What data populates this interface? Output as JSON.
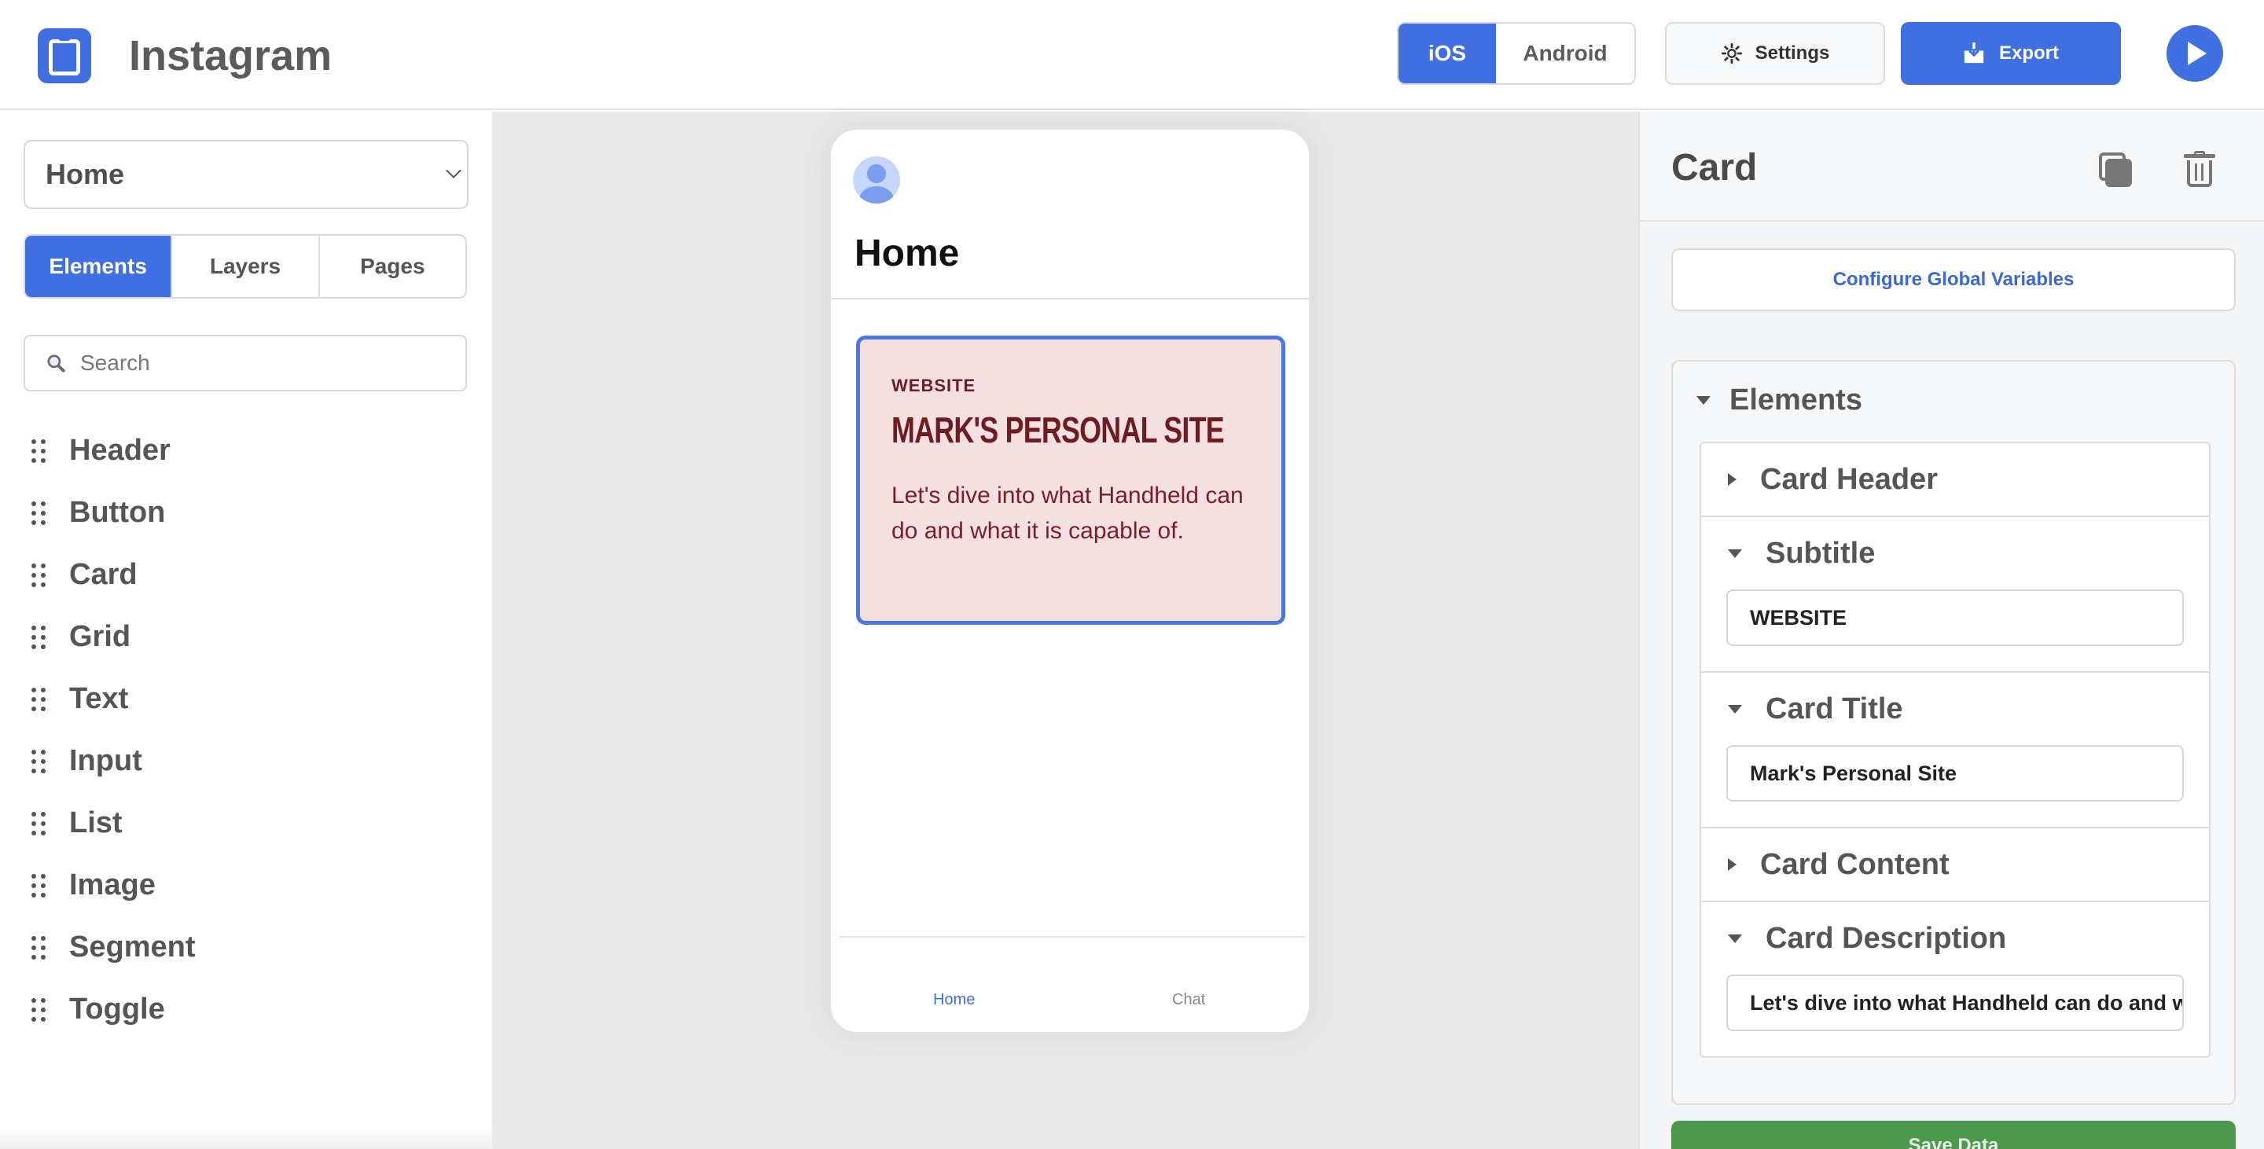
{
  "app": {
    "title": "Instagram"
  },
  "toolbar": {
    "platforms": [
      "iOS",
      "Android"
    ],
    "active_platform": "iOS",
    "settings_label": "Settings",
    "export_label": "Export"
  },
  "sidebar": {
    "page_select_value": "Home",
    "tabs": [
      "Elements",
      "Layers",
      "Pages"
    ],
    "active_tab": "Elements",
    "search_placeholder": "Search",
    "elements": [
      "Header",
      "Button",
      "Card",
      "Grid",
      "Text",
      "Input",
      "List",
      "Image",
      "Segment",
      "Toggle"
    ]
  },
  "preview": {
    "page_title": "Home",
    "card": {
      "subtitle": "WEBSITE",
      "title": "MARK'S PERSONAL SITE",
      "description": "Let's dive into what Handheld can do and what it is capable of."
    },
    "nav": [
      "Home",
      "Chat"
    ],
    "colors": {
      "accent": "#3f6fe0",
      "card_bg": "#f4e0e0",
      "card_text": "#6d1c22"
    }
  },
  "inspector": {
    "title": "Card",
    "configure_globals_label": "Configure Global Variables",
    "elements_label": "Elements",
    "sections": [
      {
        "label": "Card Header",
        "expanded": false
      },
      {
        "label": "Subtitle",
        "expanded": true,
        "value": "WEBSITE"
      },
      {
        "label": "Card Title",
        "expanded": true,
        "value": "Mark's Personal Site"
      },
      {
        "label": "Card Content",
        "expanded": false
      },
      {
        "label": "Card Description",
        "expanded": true,
        "value": "Let's dive into what Handheld can do and what it is capable of."
      }
    ],
    "save_label": "Save Data"
  }
}
